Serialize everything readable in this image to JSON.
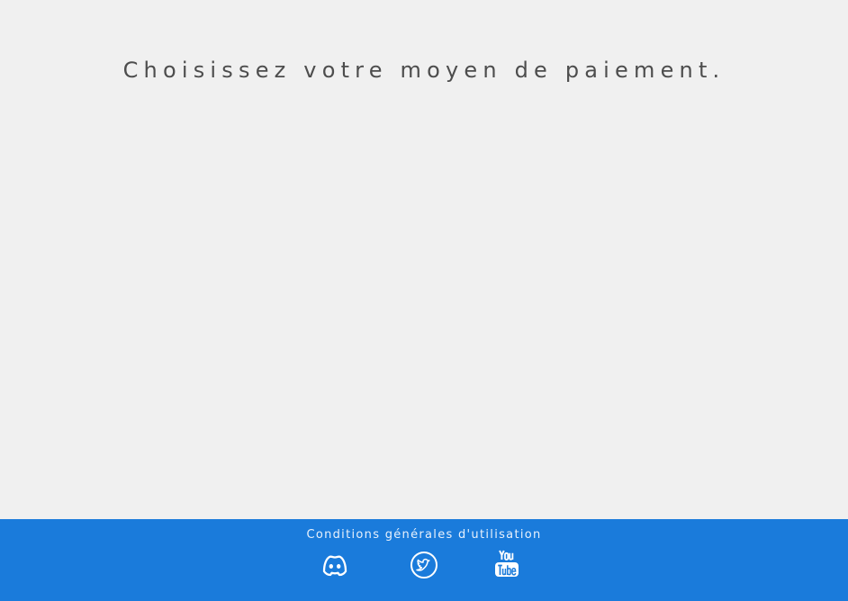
{
  "main": {
    "title": "Choisissez votre moyen de paiement."
  },
  "footer": {
    "terms_label": "Conditions générales d'utilisation",
    "social": [
      {
        "icon": "discord-icon",
        "label": "Discord"
      },
      {
        "icon": "twitter-icon",
        "label": "Twitter"
      },
      {
        "icon": "youtube-icon",
        "label": "YouTube"
      }
    ]
  },
  "colors": {
    "background": "#f0f0f0",
    "footer": "#1a7bdb",
    "title_text": "#4d4d4d",
    "footer_text": "#e8f1fc"
  }
}
